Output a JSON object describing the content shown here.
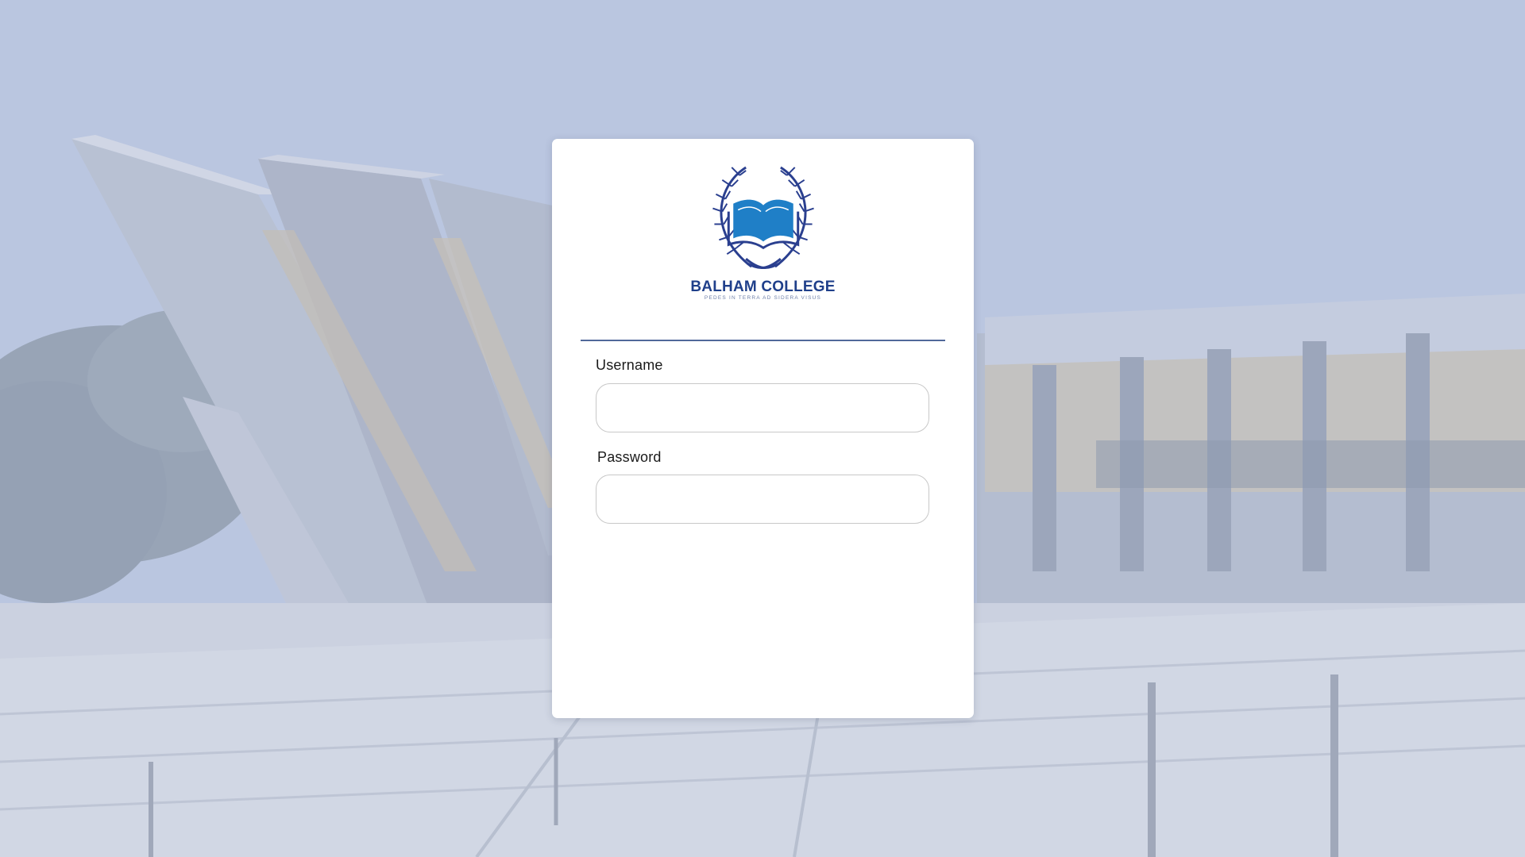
{
  "background": {
    "description_icon": "campus-building-photo"
  },
  "logo": {
    "icon": "open-book-laurel-icon",
    "name": "BALHAM COLLEGE",
    "motto": "PEDES IN TERRA AD SIDERA VISUS",
    "colors": {
      "book": "#1f7fc7",
      "laurel": "#2a3f8f",
      "text": "#1f3f8a"
    }
  },
  "form": {
    "username_label": "Username",
    "username_value": "",
    "password_label": "Password",
    "password_value": ""
  },
  "colors": {
    "divider": "#50689a",
    "card": "#ffffff"
  }
}
